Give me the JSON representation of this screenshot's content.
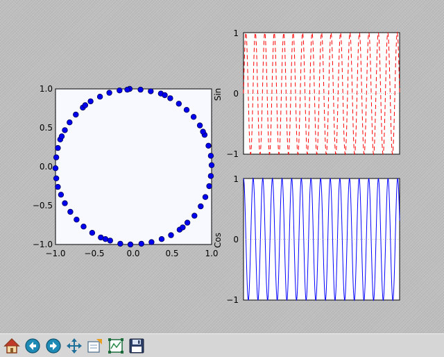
{
  "chart_data": [
    {
      "type": "scatter",
      "title": "",
      "xlim": [
        -1.0,
        1.0
      ],
      "ylim": [
        -1.0,
        1.0
      ],
      "xticks": [
        "−1.0",
        "−0.5",
        "0.0",
        "0.5",
        "1.0"
      ],
      "yticks": [
        "1.0",
        "0.5",
        "0.0",
        "−0.5",
        "−1.0"
      ],
      "points": [
        [
          0.99,
          0.14
        ],
        [
          0.96,
          0.27
        ],
        [
          0.91,
          0.41
        ],
        [
          0.85,
          0.53
        ],
        [
          0.77,
          0.64
        ],
        [
          0.68,
          0.73
        ],
        [
          0.58,
          0.81
        ],
        [
          0.47,
          0.88
        ],
        [
          0.35,
          0.94
        ],
        [
          0.22,
          0.97
        ],
        [
          0.09,
          0.99
        ],
        [
          -0.05,
          1.0
        ],
        [
          -0.18,
          0.98
        ],
        [
          -0.31,
          0.95
        ],
        [
          -0.43,
          0.9
        ],
        [
          -0.55,
          0.84
        ],
        [
          -0.65,
          0.76
        ],
        [
          -0.74,
          0.67
        ],
        [
          -0.82,
          0.57
        ],
        [
          -0.88,
          0.47
        ],
        [
          -0.94,
          0.35
        ],
        [
          -0.97,
          0.24
        ],
        [
          -0.99,
          0.12
        ],
        [
          -1.0,
          -0.02
        ],
        [
          -0.99,
          -0.15
        ],
        [
          -0.97,
          -0.26
        ],
        [
          -0.93,
          -0.36
        ],
        [
          -0.88,
          -0.47
        ],
        [
          -0.81,
          -0.58
        ],
        [
          -0.73,
          -0.68
        ],
        [
          -0.64,
          -0.77
        ],
        [
          -0.53,
          -0.85
        ],
        [
          -0.42,
          -0.91
        ],
        [
          -0.3,
          -0.95
        ],
        [
          -0.17,
          -0.99
        ],
        [
          -0.04,
          -1.0
        ],
        [
          0.1,
          -0.99
        ],
        [
          0.23,
          -0.97
        ],
        [
          0.36,
          -0.93
        ],
        [
          0.48,
          -0.88
        ],
        [
          0.59,
          -0.81
        ],
        [
          0.69,
          -0.72
        ],
        [
          0.78,
          -0.63
        ],
        [
          0.86,
          -0.51
        ],
        [
          0.92,
          -0.39
        ],
        [
          0.97,
          -0.25
        ],
        [
          0.99,
          -0.12
        ],
        [
          1.0,
          0.02
        ],
        [
          -0.62,
          0.79
        ],
        [
          0.4,
          0.92
        ],
        [
          -0.92,
          0.39
        ],
        [
          0.63,
          -0.78
        ],
        [
          -0.36,
          -0.93
        ],
        [
          0.89,
          0.45
        ],
        [
          -0.08,
          0.99
        ]
      ],
      "marker_color": "#0000ee",
      "marker_edge": "#000055",
      "bg": "#f8f8ff"
    },
    {
      "type": "line",
      "ylabel": "Sin",
      "ylim": [
        -1,
        1
      ],
      "yticks": [
        "1",
        "0",
        "−1"
      ],
      "cycles": 16.5,
      "phase": 0,
      "line_style": "dashed",
      "color": "#ff0000"
    },
    {
      "type": "line",
      "ylabel": "Cos",
      "ylim": [
        -1,
        1
      ],
      "yticks": [
        "1",
        "0",
        "−1"
      ],
      "cycles": 16.2,
      "phase": 1.5708,
      "line_style": "solid",
      "color": "#0000ff"
    }
  ],
  "toolbar": {
    "buttons": [
      {
        "name": "home-button",
        "icon": "home-icon"
      },
      {
        "name": "back-button",
        "icon": "back-arrow-icon"
      },
      {
        "name": "forward-button",
        "icon": "forward-arrow-icon"
      },
      {
        "name": "pan-button",
        "icon": "move-icon"
      },
      {
        "name": "zoom-button",
        "icon": "zoom-rect-icon"
      },
      {
        "name": "subplots-button",
        "icon": "subplots-icon"
      },
      {
        "name": "save-button",
        "icon": "floppy-disk-icon"
      }
    ]
  }
}
